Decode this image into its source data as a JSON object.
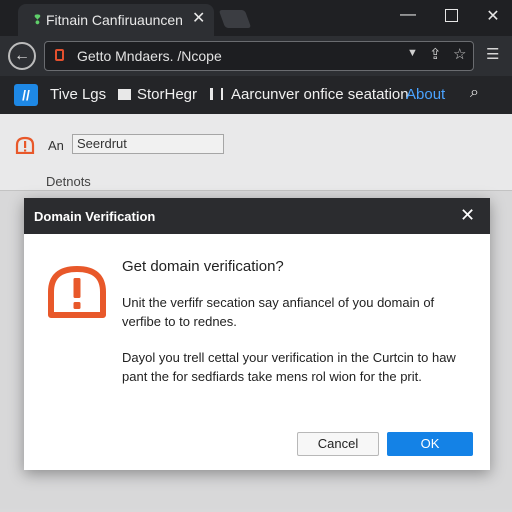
{
  "window": {
    "tab_title": "Fitnain Canfiruauncen",
    "tab_close": "✕",
    "minimize": "—",
    "close": "✕"
  },
  "toolbar": {
    "back": "←",
    "url": "Getto Mndaers. /Ncope",
    "dropdown": "▼",
    "share": "⇪",
    "star": "☆",
    "menu": "☰"
  },
  "nav": {
    "brand": "//",
    "items": [
      "Tive Lgs",
      "StorHegr",
      "Aarcunver onfice seatation"
    ],
    "about": "About",
    "search": "⌕"
  },
  "page": {
    "field_label": "An",
    "field_value": "Seerdrut",
    "section_label": "Detnots"
  },
  "dialog": {
    "title": "Domain Verification",
    "close": "✕",
    "heading": "Get domain verification?",
    "text1": "Unit the verfifr secation say anfiancel of you domain of verfibe to to rednes.",
    "text2": "Dayol you trell cettal your verification in the Curtcin to haw pant the for sedfiards take mens rol wion for the prit.",
    "cancel_label": "Cancel",
    "ok_label": "OK"
  },
  "colors": {
    "accent": "#1482e6",
    "warning": "#e8582a",
    "link": "#4aa3ff"
  }
}
